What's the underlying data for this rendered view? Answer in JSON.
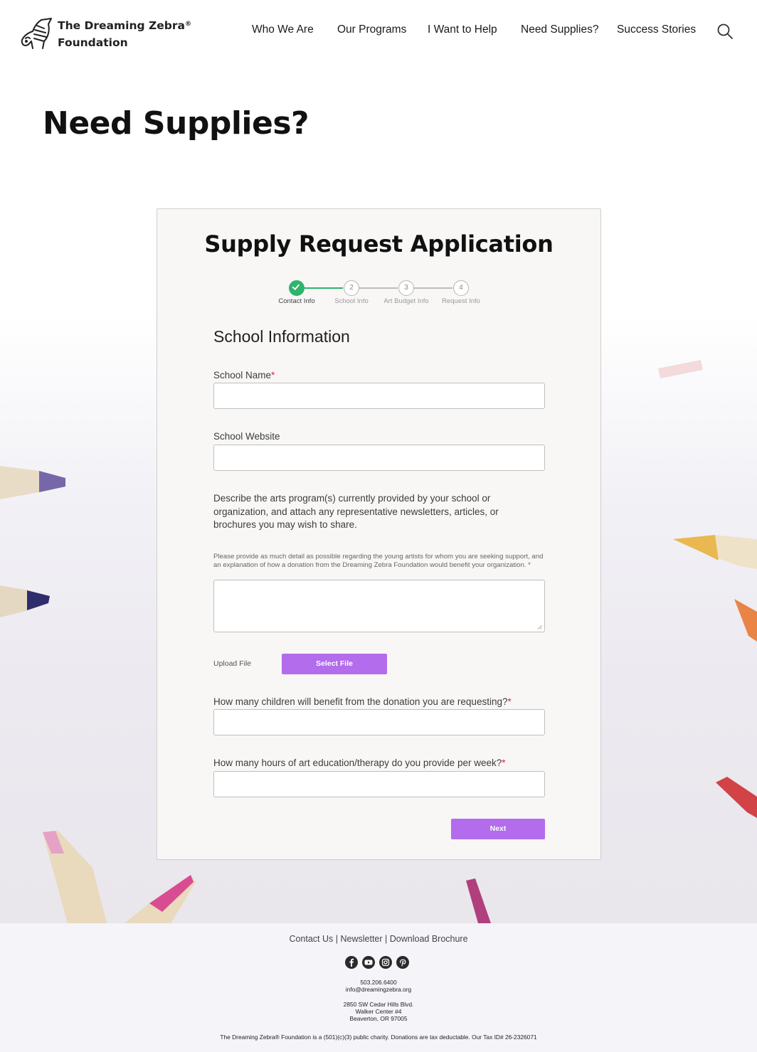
{
  "brand": {
    "name_line1": "The Dreaming Zebra",
    "registered": "®",
    "name_line2": "Foundation"
  },
  "nav": {
    "items": [
      {
        "label": "Who We Are"
      },
      {
        "label": "Our Programs"
      },
      {
        "label": "I Want to Help"
      },
      {
        "label": "Need Supplies?"
      },
      {
        "label": "Success Stories"
      }
    ],
    "search_icon": "search-icon"
  },
  "page": {
    "title": "Need Supplies?"
  },
  "form": {
    "title": "Supply Request Application",
    "steps": [
      {
        "number": "1",
        "label": "Contact Info",
        "state": "complete"
      },
      {
        "number": "2",
        "label": "School Info",
        "state": "current"
      },
      {
        "number": "3",
        "label": "Art Budget Info",
        "state": "pending"
      },
      {
        "number": "4",
        "label": "Request Info",
        "state": "pending"
      }
    ],
    "section_title": "School Information",
    "required_mark": "*",
    "fields": {
      "school_name": {
        "label": "School Name",
        "value": ""
      },
      "school_website": {
        "label": "School Website",
        "value": ""
      },
      "arts_description": {
        "prompt": "Describe the arts program(s) currently provided by your school or organization, and attach any representative newsletters, articles, or brochures you may wish to share.",
        "help": "Please provide as much detail as possible regarding the young artists for whom you are seeking support, and an explanation of how a donation from the Dreaming Zebra Foundation would benefit your organization. *",
        "value": ""
      },
      "upload": {
        "label": "Upload File",
        "button": "Select File"
      },
      "children_count": {
        "label": "How many children will benefit from the donation you are requesting?",
        "value": ""
      },
      "hours_per_week": {
        "label": "How many hours of art education/therapy do you provide per week?",
        "value": ""
      }
    },
    "next_button": "Next"
  },
  "footer": {
    "links": [
      "Contact Us",
      "Newsletter",
      "Download Brochure"
    ],
    "link_separator": "|",
    "social_icons": [
      "facebook-icon",
      "youtube-icon",
      "instagram-icon",
      "pinterest-icon"
    ],
    "phone": "503.206.6400",
    "email": "info@dreamingzebra.org",
    "address_line1": "2850 SW Cedar Hills Blvd.",
    "address_line2": "Walker Center #4",
    "address_line3": "Beaverton, OR 97005",
    "legal": "The Dreaming Zebra® Foundation is a (501)(c)(3) public charity. Donations are tax deductable. Our Tax ID# 26-2326071"
  },
  "colors": {
    "accent_purple": "#b26cec",
    "step_complete_green": "#2fb36d",
    "required_pink": "#d2246f"
  }
}
